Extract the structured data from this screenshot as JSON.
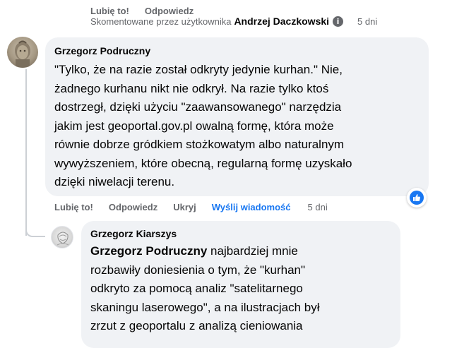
{
  "top_actions": {
    "like": "Lubię to!",
    "reply": "Odpowiedz"
  },
  "commented_by": {
    "prefix": "Skomentowane przez użytkownika",
    "author": "Andrzej Daczkowski",
    "info_icon": "info-icon",
    "time": "5 dni"
  },
  "main_comment": {
    "author": "Grzegorz Podruczny",
    "text": "\"Tylko, że na razie został odkryty jedynie kurhan.\" Nie,\nżadnego kurhanu nikt nie odkrył. Na razie tylko ktoś\ndostrzegł, dzięki użyciu \"zaawansowanego\" narzędzia\njakim jest geoportal.gov.pl owalną formę, która może\nrównie dobrze gródkiem stożkowatym albo naturalnym\nwywyższeniem, które obecną, regularną formę uzyskało\ndzięki niwelacji terenu.",
    "reaction_icon": "like-icon",
    "actions": {
      "like": "Lubię to!",
      "reply": "Odpowiedz",
      "block": "Ukryj",
      "send": "Wyślij wiadomość",
      "time": "5 dni"
    }
  },
  "reply_comment": {
    "author": "Grzegorz Kiarszys",
    "mention": "Grzegorz Podruczny",
    "text": " najbardziej mnie\nrozbawiły doniesienia o tym, że \"kurhan\"\nodkryto za pomocą analiz \"satelitarnego\nskaningu laserowego\", a na ilustracjach był\nzrzut z geoportalu z analizą cieniowania"
  },
  "colors": {
    "bubble": "#f0f2f5",
    "secondary_text": "#65676b",
    "accent": "#1877f2"
  }
}
